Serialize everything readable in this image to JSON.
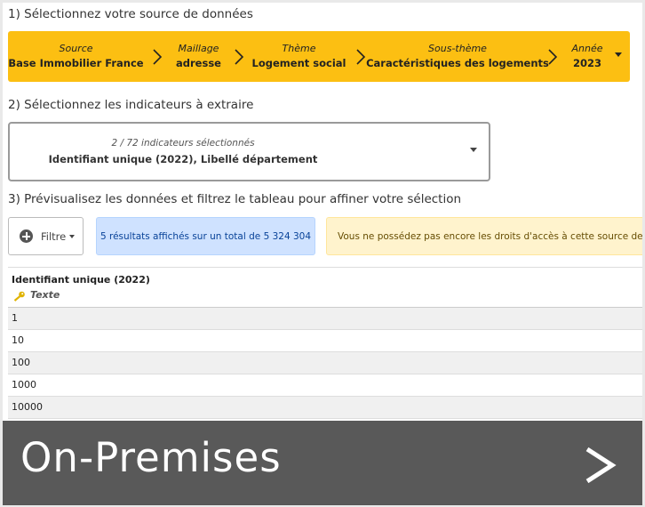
{
  "steps": {
    "step1": "1) Sélectionnez votre source de données",
    "step2": "2) Sélectionnez les indicateurs à extraire",
    "step3": "3) Prévisualisez les données et filtrez le tableau pour affiner votre sélection"
  },
  "breadcrumb": {
    "items": [
      {
        "label": "Source",
        "value": "Base Immobilier France"
      },
      {
        "label": "Maillage",
        "value": "adresse"
      },
      {
        "label": "Thème",
        "value": "Logement social"
      },
      {
        "label": "Sous-thème",
        "value": "Caractéristiques des logements"
      },
      {
        "label": "Année",
        "value": "2023"
      }
    ],
    "color": "#fcbf12"
  },
  "indicators": {
    "count": "2 / 72 indicateurs sélectionnés",
    "selected": "Identifiant unique (2022), Libellé département"
  },
  "filter": {
    "label": "Filtre"
  },
  "results_info": "5 résultats affichés sur un total de 5 324 304",
  "access_warning": "Vous ne possédez pas encore les droits d'accès à cette source de données",
  "table": {
    "column_title": "Identifiant unique (2022)",
    "column_type": "Texte",
    "column_type_icon": "key-icon",
    "rows": [
      "1",
      "10",
      "100",
      "1000",
      "10000"
    ]
  },
  "banner": {
    "text": "On-Premises",
    "icon": "chevron-right-icon"
  }
}
